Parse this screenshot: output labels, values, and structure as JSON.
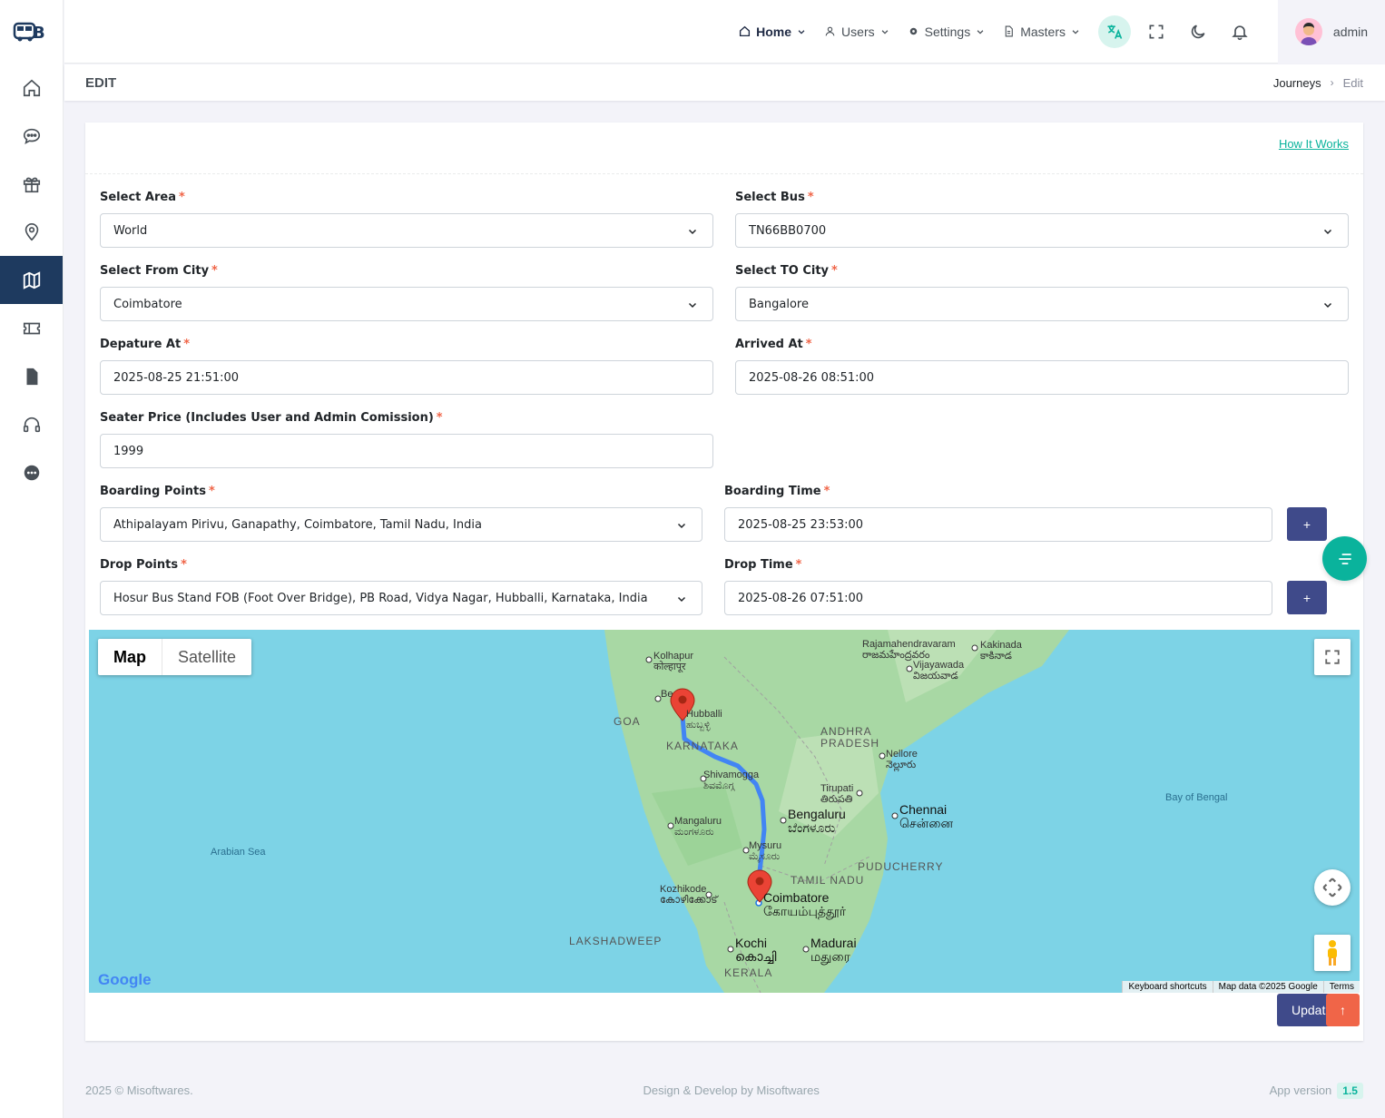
{
  "nav": {
    "home": "Home",
    "users": "Users",
    "settings": "Settings",
    "masters": "Masters",
    "username": "admin"
  },
  "page": {
    "title": "EDIT",
    "breadcrumb": {
      "parent": "Journeys",
      "current": "Edit"
    },
    "how_it_works": "How It Works"
  },
  "form": {
    "area": {
      "label": "Select Area",
      "value": "World"
    },
    "bus": {
      "label": "Select Bus",
      "value": "TN66BB0700"
    },
    "from_city": {
      "label": "Select From City",
      "value": "Coimbatore"
    },
    "to_city": {
      "label": "Select TO City",
      "value": "Bangalore"
    },
    "departure": {
      "label": "Depature At",
      "value": "2025-08-25 21:51:00"
    },
    "arrival": {
      "label": "Arrived At",
      "value": "2025-08-26 08:51:00"
    },
    "price": {
      "label": "Seater Price (Includes User and Admin Comission)",
      "value": "1999"
    },
    "boarding_point": {
      "label": "Boarding Points",
      "value": "Athipalayam Pirivu, Ganapathy, Coimbatore, Tamil Nadu, India"
    },
    "boarding_time": {
      "label": "Boarding Time",
      "value": "2025-08-25 23:53:00"
    },
    "drop_point": {
      "label": "Drop Points",
      "value": "Hosur Bus Stand FOB (Foot Over Bridge), PB Road, Vidya Nagar, Hubballi, Karnataka, India"
    },
    "drop_time": {
      "label": "Drop Time",
      "value": "2025-08-26 07:51:00"
    },
    "add_label": "+",
    "required_mark": "*",
    "update_label": "Updat",
    "scroll_top": "↑"
  },
  "map": {
    "type_map": "Map",
    "type_satellite": "Satellite",
    "footer_shortcuts": "Keyboard shortcuts",
    "footer_data": "Map data ©2025 Google",
    "footer_terms": "Terms",
    "google": "Google",
    "labels": {
      "kolhapur": "Kolhapur",
      "kolhapur_local": "कोल्हापूर",
      "rajahmundry": "Rajamahendravaram",
      "rajahmundry_local": "రాజమహేంద్రవరం",
      "kakinada": "Kakinada",
      "kakinada_local": "కాకినాడ",
      "vijayawada": "Vijayawada",
      "vijayawada_local": "విజయవాడ",
      "belgaum": "Be",
      "hubballi": "Hubballi",
      "hubballi_local": "ಹುಬ್ಬಳ್ಳಿ",
      "goa": "GOA",
      "andhra": "ANDHRA",
      "pradesh": "PRADESH",
      "karnataka": "KARNATAKA",
      "nellore": "Nellore",
      "nellore_local": "నెల్లూరు",
      "shivamogga": "Shivamogga",
      "shivamogga_local": "ಶಿವಮೊಗ್ಗ",
      "tirupati": "Tirupati",
      "tirupati_local": "తిరుపతి",
      "bay_of_bengal": "Bay of Bengal",
      "chennai": "Chennai",
      "chennai_local": "சென்னை",
      "bengaluru": "Bengaluru",
      "bengaluru_local": "ಬೆಂಗಳೂರು",
      "mangaluru": "Mangaluru",
      "mangaluru_local": "ಮಂಗಳೂರು",
      "arabian_sea": "Arabian Sea",
      "mysuru": "Mysuru",
      "mysuru_local": "ಮೈಸೂರು",
      "puducherry": "PUDUCHERRY",
      "tamil_nadu": "TAMIL NADU",
      "kozhikode": "Kozhikode",
      "kozhikode_local": "കോഴിക്കോട്",
      "coimbatore": "Coimbatore",
      "coimbatore_local": "கோயம்புத்தூர்",
      "lakshadweep": "LAKSHADWEEP",
      "kochi": "Kochi",
      "kochi_local": "കൊച്ചി",
      "madurai": "Madurai",
      "madurai_local": "மதுரை",
      "kerala": "KERALA"
    }
  },
  "footer": {
    "copyright": "2025 © Misoftwares.",
    "credit": "Design & Develop by Misoftwares",
    "version_label": "App version",
    "version": "1.5"
  },
  "colors": {
    "primary": "#3f4a8a",
    "accent": "#0ab39c",
    "danger": "#f06548",
    "sidebar_active": "#1e3a5f",
    "water": "#7dd3e6",
    "land": "#a8d8a4",
    "route": "#4285f4"
  }
}
